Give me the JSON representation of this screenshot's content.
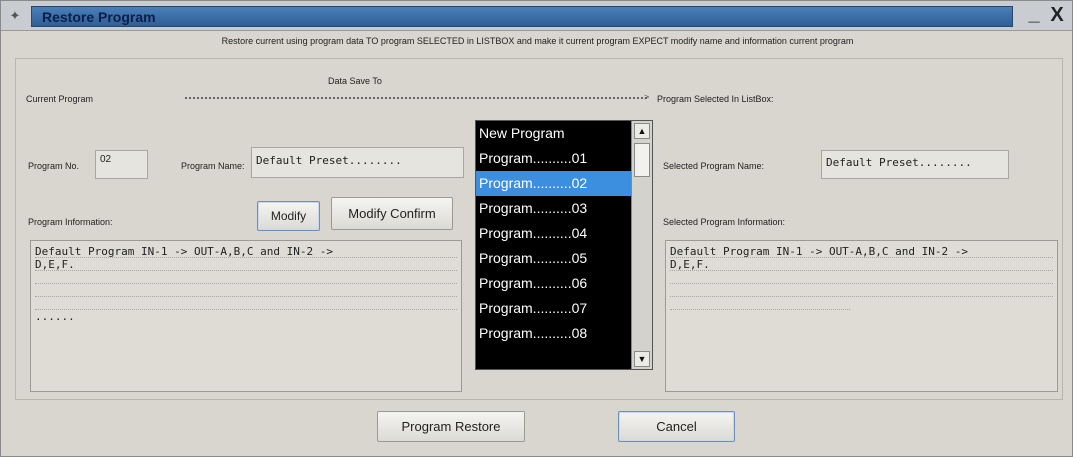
{
  "window": {
    "title": "Restore Program",
    "minimize": "_",
    "close": "X"
  },
  "description": "Restore current using program data TO program SELECTED in LISTBOX and make it current program EXPECT modify name and information current program",
  "left": {
    "current_program_label": "Current Program",
    "program_no_label": "Program No.",
    "program_no_value": "02",
    "program_name_label": "Program Name:",
    "program_name_value": "Default Preset........",
    "program_info_label": "Program Information:",
    "modify_button": "Modify",
    "modify_confirm_button": "Modify Confirm",
    "program_info_lines": [
      "Default Program IN-1 -> OUT-A,B,C and IN-2 ->",
      "D,E,F.",
      "",
      "",
      "",
      "......"
    ]
  },
  "middle": {
    "data_save_to_label": "Data Save To",
    "arrow_head": ">",
    "listbox_items": [
      {
        "label": "New Program",
        "selected": false
      },
      {
        "label": "Program..........01",
        "selected": false
      },
      {
        "label": "Program..........02",
        "selected": true
      },
      {
        "label": "Program..........03",
        "selected": false
      },
      {
        "label": "Program..........04",
        "selected": false
      },
      {
        "label": "Program..........05",
        "selected": false
      },
      {
        "label": "Program..........06",
        "selected": false
      },
      {
        "label": "Program..........07",
        "selected": false
      },
      {
        "label": "Program..........08",
        "selected": false
      }
    ],
    "scroll_up": "▲",
    "scroll_down": "▼"
  },
  "right": {
    "selected_in_listbox_label": "Program Selected In ListBox:",
    "selected_name_label": "Selected Program Name:",
    "selected_name_value": "Default Preset........",
    "selected_info_label": "Selected Program Information:",
    "selected_info_lines": [
      "Default Program IN-1 -> OUT-A,B,C and IN-2 ->",
      "D,E,F.",
      "",
      "",
      "",
      ""
    ]
  },
  "footer": {
    "restore_button": "Program Restore",
    "cancel_button": "Cancel"
  },
  "colors": {
    "title_bar": "#2e5f96",
    "window_bg": "#d8d6cf",
    "listbox_bg": "#000000",
    "listbox_selected": "#3b8fde"
  }
}
